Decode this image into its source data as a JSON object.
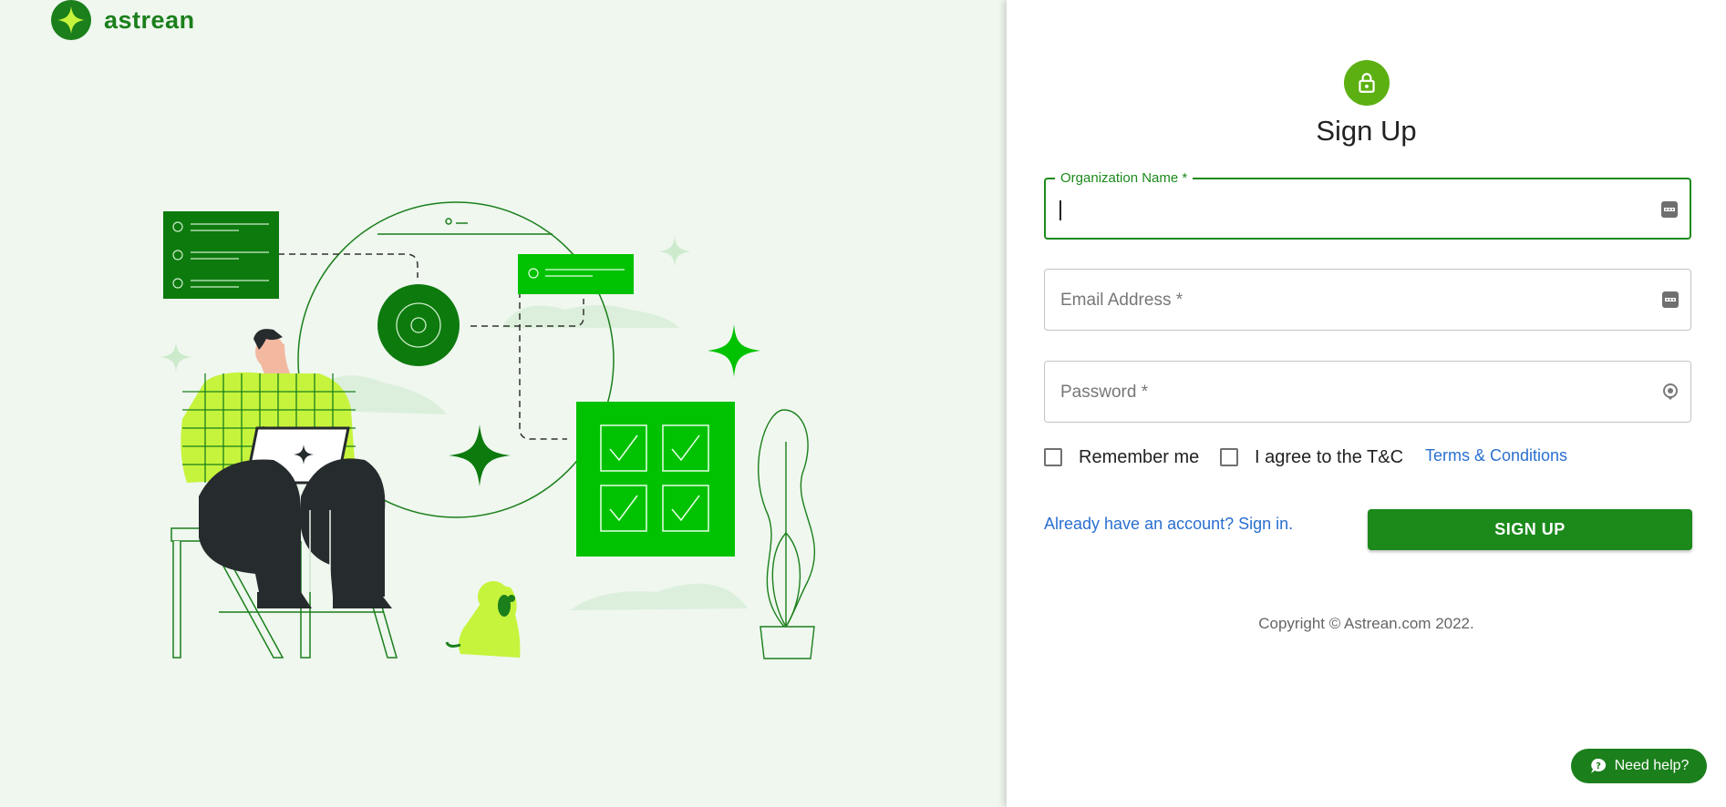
{
  "brand": {
    "name": "astrean"
  },
  "form": {
    "title": "Sign Up",
    "org": {
      "label": "Organization Name *",
      "value": ""
    },
    "email": {
      "label": "Email Address *",
      "value": ""
    },
    "password": {
      "label": "Password *",
      "value": ""
    },
    "remember": {
      "label": "Remember me",
      "checked": false
    },
    "agree": {
      "label": "I agree to the T&C",
      "checked": false
    },
    "terms_link": "Terms & Conditions",
    "signin_link": "Already have an account? Sign in.",
    "submit": "SIGN UP"
  },
  "footer": {
    "copyright": "Copyright © Astrean.com 2022."
  },
  "help": {
    "label": "Need help?"
  },
  "colors": {
    "brand_green": "#1b8a1b",
    "bright_green": "#00c200",
    "lime": "#c6f43c",
    "bg_left": "#eff7ef"
  },
  "icons": [
    "logo-star-icon",
    "lock-icon",
    "password-manager-icon",
    "visibility-icon",
    "help-chat-icon"
  ]
}
